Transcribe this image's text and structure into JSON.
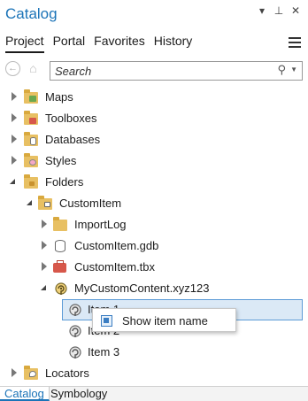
{
  "window": {
    "title": "Catalog",
    "controls": {
      "dropdown": "▾",
      "pin": "⊥",
      "close": "✕"
    }
  },
  "tabs": [
    "Project",
    "Portal",
    "Favorites",
    "History"
  ],
  "search": {
    "placeholder": "Search",
    "value": ""
  },
  "tree": {
    "maps": "Maps",
    "toolboxes": "Toolboxes",
    "databases": "Databases",
    "styles": "Styles",
    "folders": "Folders",
    "customitem_folder": "CustomItem",
    "importlog": "ImportLog",
    "gdb": "CustomItem.gdb",
    "tbx": "CustomItem.tbx",
    "xyz": "MyCustomContent.xyz123",
    "item1": "Item 1",
    "item2": "Item 2",
    "item3": "Item 3",
    "locators": "Locators"
  },
  "context_menu": {
    "show_item_name": "Show item name"
  },
  "bottom_tabs": {
    "catalog": "Catalog",
    "symbology": "Symbology"
  },
  "colors": {
    "accent": "#1c74b8",
    "selection": "#dbe9f6",
    "folder": "#e8c063"
  },
  "icons": {
    "maps": "map-folder-icon",
    "toolboxes": "toolbox-folder-icon",
    "databases": "database-folder-icon",
    "styles": "style-folder-icon",
    "folders": "folder-icon",
    "customitem": "home-folder-icon",
    "importlog": "folder-icon",
    "gdb": "geodatabase-icon",
    "tbx": "toolbox-icon",
    "xyz": "custom-content-icon",
    "item": "custom-item-icon",
    "locators": "locator-folder-icon"
  }
}
